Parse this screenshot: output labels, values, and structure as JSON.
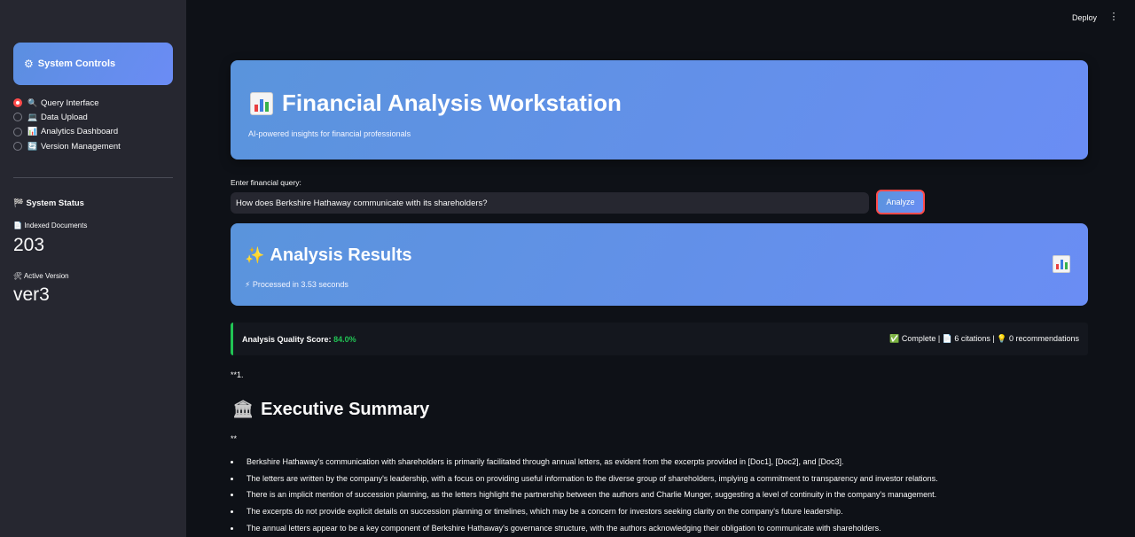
{
  "topbar": {
    "deploy_label": "Deploy",
    "menu_glyph": "⋮"
  },
  "sidebar": {
    "controls_label": "System Controls",
    "nav": [
      {
        "icon": "🔍",
        "label": "Query Interface",
        "selected": true
      },
      {
        "icon": "💻",
        "label": "Data Upload",
        "selected": false
      },
      {
        "icon": "📊",
        "label": "Analytics Dashboard",
        "selected": false
      },
      {
        "icon": "🔄",
        "label": "Version Management",
        "selected": false
      }
    ],
    "status_title": "System Status",
    "indexed_label": "Indexed Documents",
    "indexed_value": "203",
    "version_label": "Active Version",
    "version_value": "ver3"
  },
  "hero": {
    "title": "Financial Analysis Workstation",
    "subtitle": "AI-powered insights for financial professionals"
  },
  "query": {
    "label": "Enter financial query:",
    "value": "How does Berkshire Hathaway communicate with its shareholders?",
    "button": "Analyze"
  },
  "results": {
    "title": "Analysis Results",
    "processed": "⚡ Processed in 3.53 seconds"
  },
  "quality": {
    "label": "Analysis Quality Score:",
    "score": "84.0%",
    "summary": "✅ Complete | 📄 6 citations | 💡 0 recommendations"
  },
  "content": {
    "prefix": "**1.",
    "heading": "Executive Summary",
    "suffix": "**",
    "bullets": [
      "Berkshire Hathaway's communication with shareholders is primarily facilitated through annual letters, as evident from the excerpts provided in [Doc1], [Doc2], and [Doc3].",
      "The letters are written by the company's leadership, with a focus on providing useful information to the diverse group of shareholders, implying a commitment to transparency and investor relations.",
      "There is an implicit mention of succession planning, as the letters highlight the partnership between the authors and Charlie Munger, suggesting a level of continuity in the company's management.",
      "The excerpts do not provide explicit details on succession planning or timelines, which may be a concern for investors seeking clarity on the company's future leadership.",
      "The annual letters appear to be a key component of Berkshire Hathaway's governance structure, with the authors acknowledging their obligation to communicate with shareholders."
    ]
  }
}
